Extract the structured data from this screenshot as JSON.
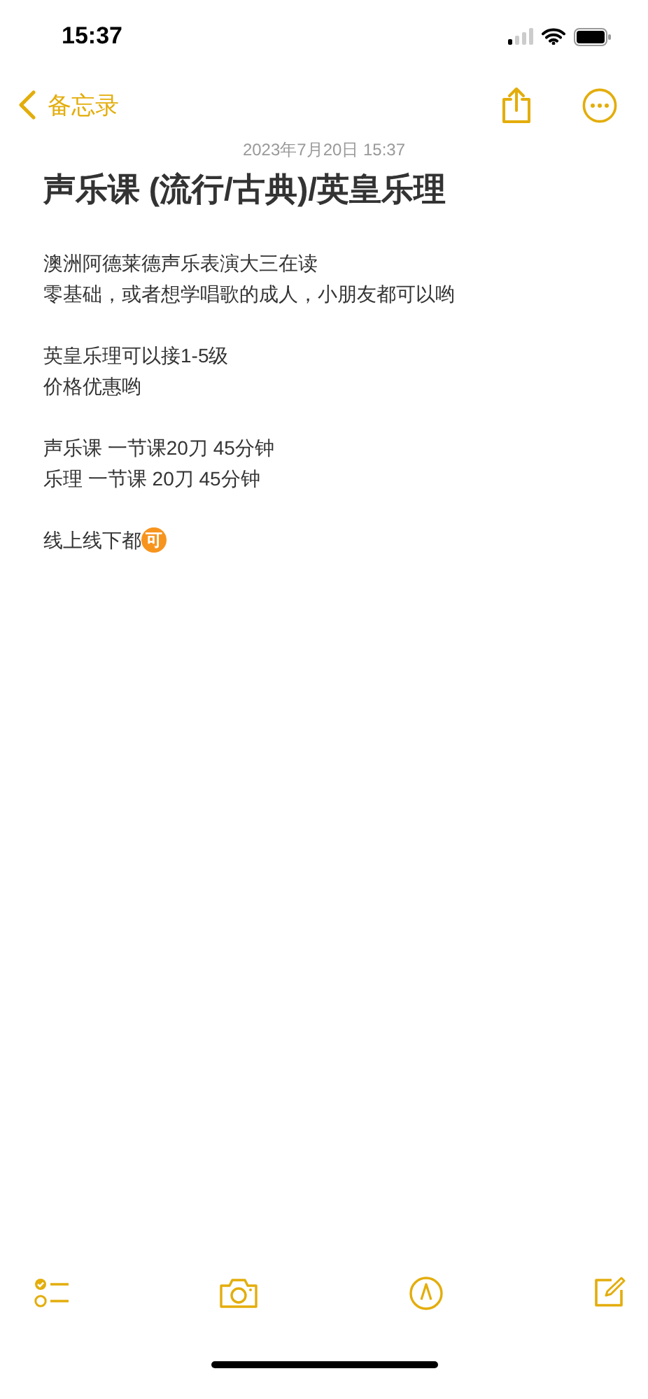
{
  "status_bar": {
    "time": "15:37"
  },
  "nav": {
    "back_label": "备忘录"
  },
  "note": {
    "date": "2023年7月20日 15:37",
    "title": "声乐课 (流行/古典)/英皇乐理",
    "paragraphs": [
      [
        {
          "text": "澳洲阿德莱德声乐表演大三在读"
        },
        {
          "text": "零基础，或者想学唱歌的成人，小朋友都可以哟"
        }
      ],
      [
        {
          "text": "英皇乐理可以接1-5级"
        },
        {
          "text": "价格优惠哟"
        }
      ],
      [
        {
          "text": "声乐课 一节课20刀 45分钟"
        },
        {
          "text": "乐理 一节课  20刀  45分钟"
        }
      ],
      [
        {
          "text": "线上线下都",
          "badge": "可"
        }
      ]
    ]
  }
}
